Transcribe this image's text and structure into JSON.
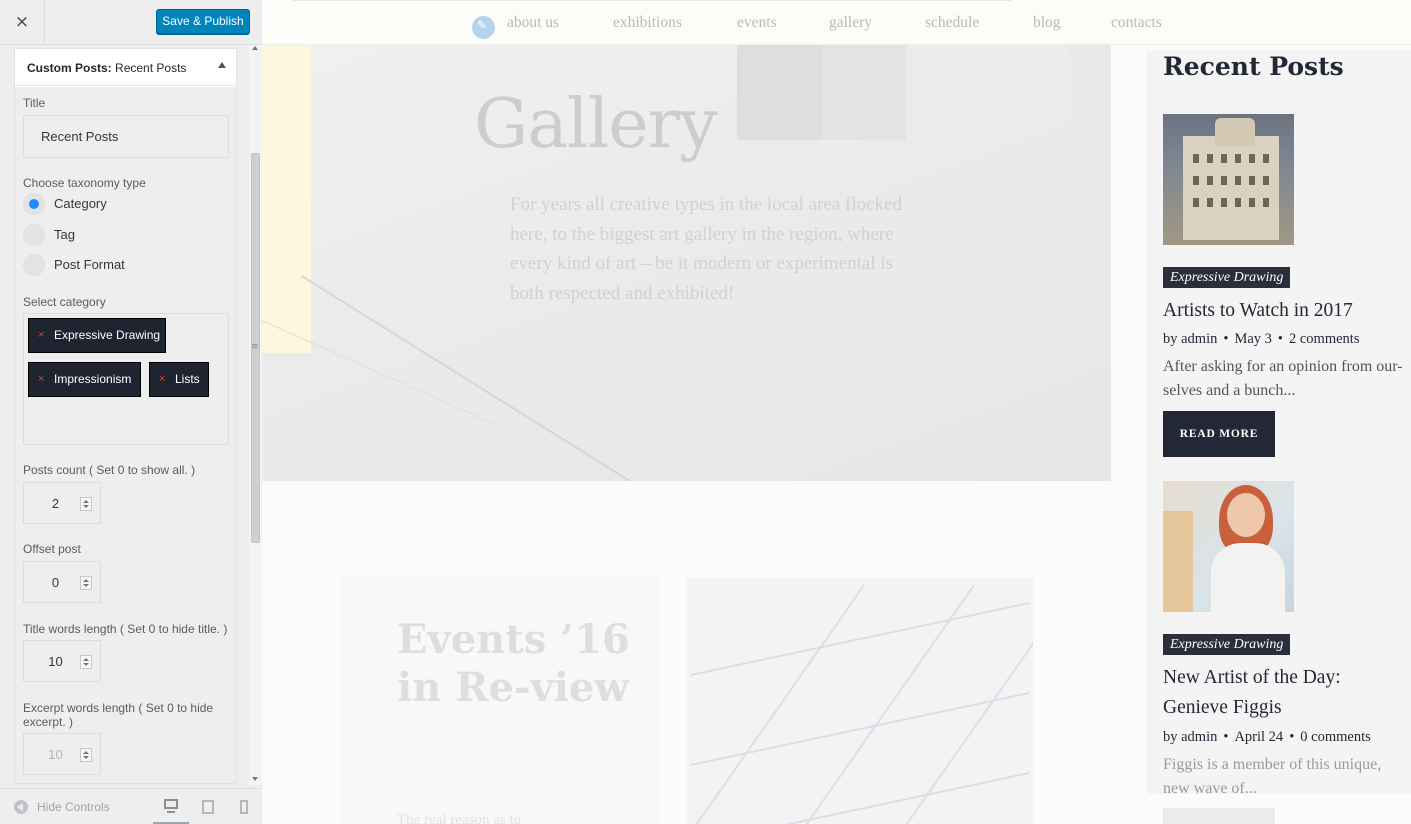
{
  "customizer": {
    "close_icon": "×",
    "save_label": "Save & Publish",
    "panel": {
      "title_prefix": "Custom Posts:",
      "title_name": "Recent Posts"
    },
    "fields": {
      "title_label": "Title",
      "title_value": "Recent Posts",
      "taxonomy_label": "Choose taxonomy type",
      "taxonomy_options": [
        "Category",
        "Tag",
        "Post Format"
      ],
      "taxonomy_selected": "Category",
      "category_label": "Select category",
      "categories": [
        "Expressive Drawing",
        "Impressionism",
        "Lists"
      ],
      "chip_remove_icon": "×",
      "posts_count_label": "Posts count ( Set 0 to show all. )",
      "posts_count_value": "2",
      "offset_label": "Offset post",
      "offset_value": "0",
      "title_words_label": "Title words length ( Set 0 to hide title. )",
      "title_words_value": "10",
      "excerpt_words_label": "Excerpt words length ( Set 0 to hide excerpt. )",
      "excerpt_words_value": "10"
    },
    "footer": {
      "hide_controls_label": "Hide Controls",
      "devices": [
        "desktop-icon",
        "tablet-icon",
        "mobile-icon"
      ],
      "active_device": "desktop"
    },
    "colors": {
      "primary_button": "#0085ba",
      "radio_selected": "#1e8cff",
      "chip_bg": "#1e2530",
      "chip_x": "#e2401c"
    }
  },
  "preview": {
    "nav": [
      "about us",
      "exhibitions",
      "events",
      "gallery",
      "schedule",
      "blog",
      "contacts"
    ],
    "hero": {
      "title": "Gallery",
      "text": "For years all creative types in the local area flocked here, to the biggest art gallery in the region, where every kind of art – be it modern or experimental is both respected and exhibited!"
    },
    "events": {
      "title": "Events ’16 in Re-view",
      "text": "The real reason as to"
    },
    "widget": {
      "title": "Recent Posts",
      "posts": [
        {
          "category": "Expressive Drawing",
          "title": "Artists to Watch in 2017",
          "author": "by admin",
          "date": "May 3",
          "comments": "2 comments",
          "excerpt": "After asking for an opinion from our-selves and a bunch...",
          "button": "READ MORE"
        },
        {
          "category": "Expressive Drawing",
          "title": "New Artist of the Day: Genieve Figgis",
          "author": "by admin",
          "date": "April 24",
          "comments": "0 comments",
          "excerpt": "Figgis is a member of this unique, new wave of..."
        }
      ]
    },
    "colors": {
      "dark": "#222836",
      "tag_bg": "#2a2f3b"
    }
  }
}
